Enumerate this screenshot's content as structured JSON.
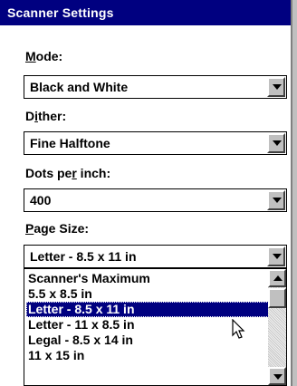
{
  "window": {
    "title": "Scanner Settings"
  },
  "mode": {
    "label_u": "M",
    "label_rest": "ode:",
    "value": "Black and White"
  },
  "dither": {
    "label_pre": "D",
    "label_u": "i",
    "label_rest": "ther:",
    "value": "Fine Halftone"
  },
  "dpi": {
    "label_pre": "Dots pe",
    "label_u": "r",
    "label_rest": " inch:",
    "value": "400"
  },
  "page_size": {
    "label_u": "P",
    "label_rest": "age Size:",
    "value": "Letter - 8.5 x 11 in",
    "options": [
      "Scanner's Maximum",
      "5.5 x 8.5 in",
      "Letter - 8.5 x 11 in",
      "Letter - 11 x 8.5 in",
      "Legal - 8.5 x 14 in",
      "11 x 15 in"
    ],
    "selected_option": "Letter - 8.5 x 11 in"
  },
  "icons": {
    "dropdown": "chevron-down-icon",
    "scroll_up": "scroll-up-icon",
    "scroll_down": "scroll-down-icon",
    "cursor": "mouse-pointer-icon"
  },
  "colors": {
    "titlebar": "#000080",
    "selection": "#000080",
    "face": "#c0c0c0"
  }
}
